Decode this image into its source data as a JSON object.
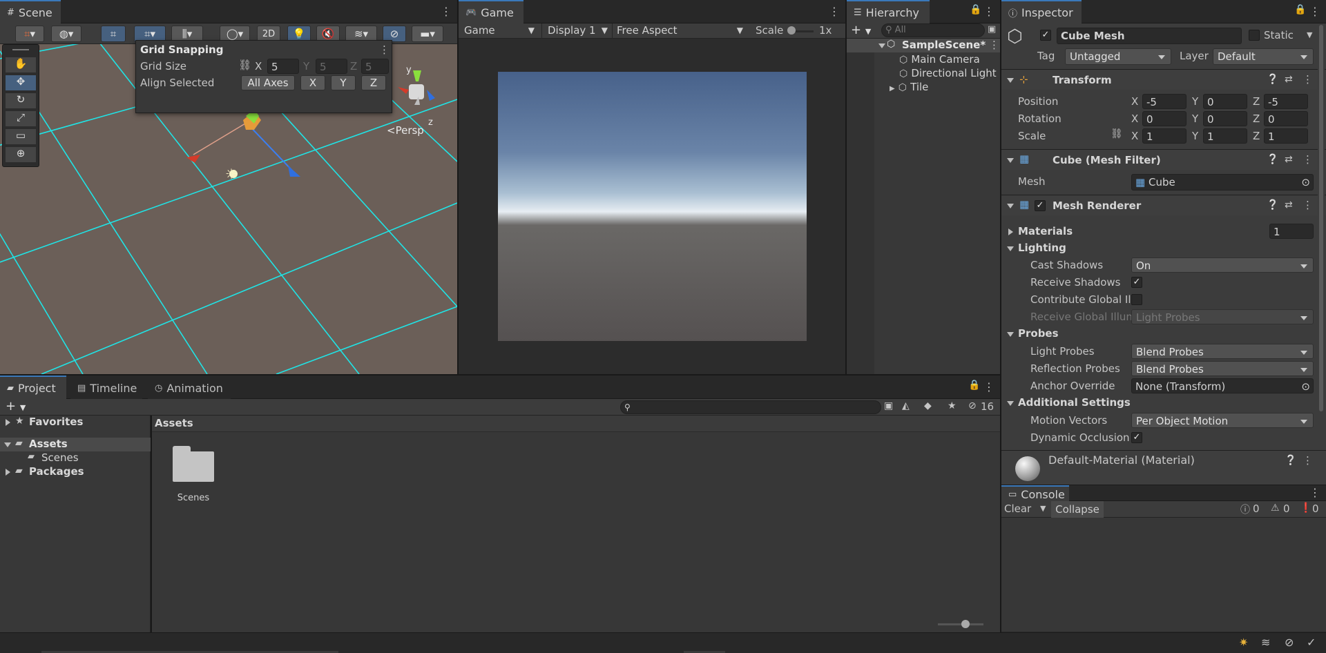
{
  "scene": {
    "tab": "Scene",
    "persp": "Persp",
    "btn_2d": "2D",
    "axis_y": "y",
    "axis_z": "z",
    "grid_snapping": {
      "title": "Grid Snapping",
      "grid_size_label": "Grid Size",
      "x_label": "X",
      "x_value": "5",
      "y_label": "Y",
      "y_value": "5",
      "z_label": "Z",
      "z_value": "5",
      "align_label": "Align Selected",
      "all_axes": "All Axes",
      "btn_x": "X",
      "btn_y": "Y",
      "btn_z": "Z"
    }
  },
  "game": {
    "tab": "Game",
    "mode": "Game",
    "display": "Display 1",
    "aspect": "Free Aspect",
    "scale_label": "Scale",
    "scale_value": "1x"
  },
  "hierarchy": {
    "tab": "Hierarchy",
    "search_placeholder": "All",
    "scene_name": "SampleScene*",
    "items": [
      "Main Camera",
      "Directional Light",
      "Tile"
    ]
  },
  "inspector": {
    "tab": "Inspector",
    "object_name": "Cube Mesh",
    "static_label": "Static",
    "tag_label": "Tag",
    "tag_value": "Untagged",
    "layer_label": "Layer",
    "layer_value": "Default",
    "transform": {
      "title": "Transform",
      "position_label": "Position",
      "rotation_label": "Rotation",
      "scale_label": "Scale",
      "x": "X",
      "y": "Y",
      "z": "Z",
      "position": [
        "-5",
        "0",
        "-5"
      ],
      "rotation": [
        "0",
        "0",
        "0"
      ],
      "scale": [
        "1",
        "1",
        "1"
      ]
    },
    "mesh_filter": {
      "title": "Cube (Mesh Filter)",
      "mesh_label": "Mesh",
      "mesh_value": "Cube"
    },
    "mesh_renderer": {
      "title": "Mesh Renderer",
      "materials_label": "Materials",
      "materials_count": "1",
      "lighting_label": "Lighting",
      "cast_shadows_label": "Cast Shadows",
      "cast_shadows_value": "On",
      "receive_shadows_label": "Receive Shadows",
      "contribute_gi_label": "Contribute Global Ill",
      "receive_gi_label": "Receive Global Illun",
      "receive_gi_value": "Light Probes",
      "probes_label": "Probes",
      "light_probes_label": "Light Probes",
      "light_probes_value": "Blend Probes",
      "reflection_probes_label": "Reflection Probes",
      "reflection_probes_value": "Blend Probes",
      "anchor_override_label": "Anchor Override",
      "anchor_override_value": "None (Transform)",
      "additional_settings_label": "Additional Settings",
      "motion_vectors_label": "Motion Vectors",
      "motion_vectors_value": "Per Object Motion",
      "dynamic_occlusion_label": "Dynamic Occlusion"
    },
    "material": {
      "title": "Default-Material (Material)"
    }
  },
  "project": {
    "tabs": [
      "Project",
      "Timeline",
      "Animation"
    ],
    "tree": {
      "favorites": "Favorites",
      "assets": "Assets",
      "scenes": "Scenes",
      "packages": "Packages"
    },
    "breadcrumb": "Assets",
    "items": [
      "Scenes"
    ],
    "hidden_count": "16"
  },
  "console": {
    "tab": "Console",
    "clear": "Clear",
    "collapse": "Collapse",
    "log_count": "0",
    "warn_count": "0",
    "error_count": "0"
  },
  "colors": {
    "accent": "#3a79bb",
    "grid_line": "#1fe4e6",
    "scene_ground": "#6b5f58",
    "scene_sky": "#5a6b88"
  }
}
